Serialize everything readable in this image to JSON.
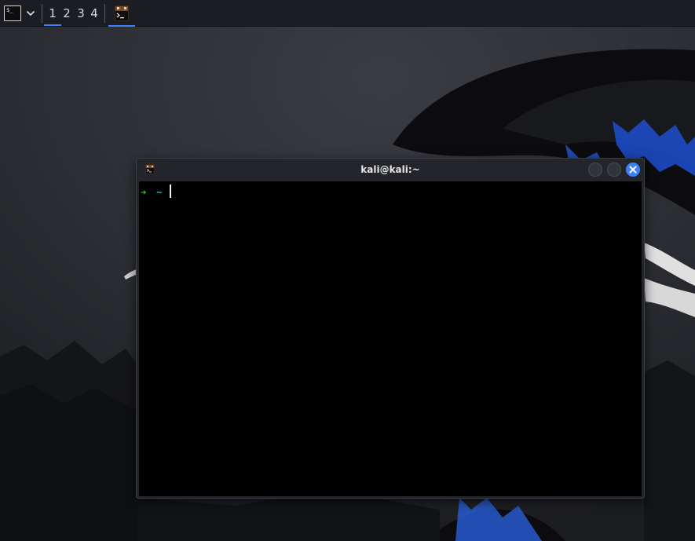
{
  "panel": {
    "launcher_icon": "terminal-icon",
    "launcher_glyph": "$_",
    "dropdown_icon": "chevron-down-icon",
    "workspaces": [
      "1",
      "2",
      "3",
      "4"
    ],
    "active_workspace": "1",
    "task_icon": "kali-terminal-icon",
    "accent_color": "#3b82f6"
  },
  "window": {
    "title": "kali@kali:~",
    "icon": "kali-terminal-icon",
    "buttons": [
      "minimize-icon",
      "maximize-icon",
      "close-icon"
    ]
  },
  "terminal": {
    "prompt_arrow": "➜",
    "prompt_dir": "~",
    "prompt_arrow_color": "#31c13a",
    "prompt_dir_color": "#24b6cf",
    "background": "#000000"
  },
  "desktop": {
    "wallpaper": "kali-dragon-wallpaper"
  }
}
